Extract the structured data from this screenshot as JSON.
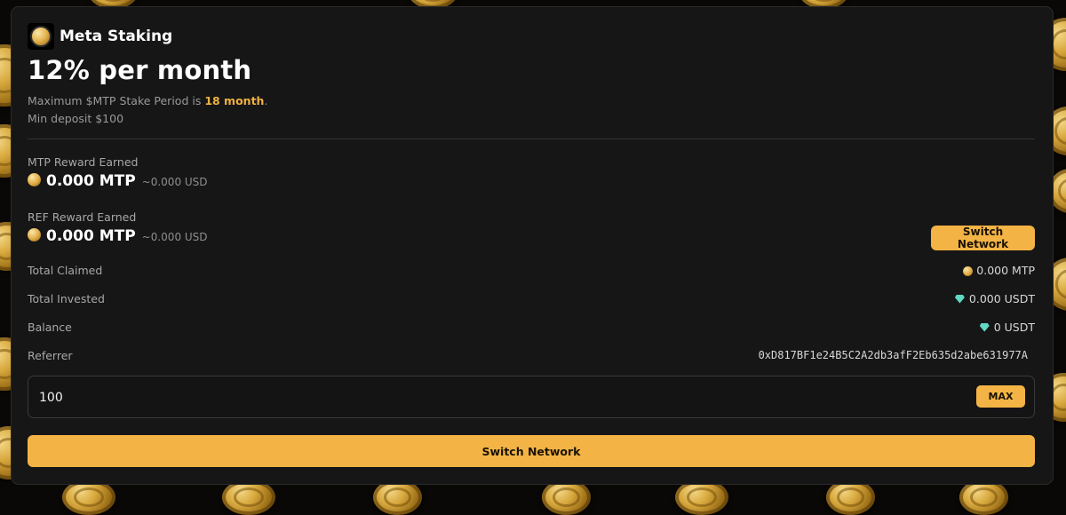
{
  "brand": {
    "name": "Meta Staking"
  },
  "headline": "12% per month",
  "info": {
    "period_prefix": "Maximum $MTP Stake Period is ",
    "period_value": "18 month",
    "period_suffix": ".",
    "min_deposit": "Min deposit $100"
  },
  "mtp_reward": {
    "label": "MTP Reward Earned",
    "amount": "0.000 MTP",
    "usd": "~0.000 USD"
  },
  "ref_reward": {
    "label": "REF Reward Earned",
    "amount": "0.000 MTP",
    "usd": "~0.000 USD"
  },
  "switch_network_small": "Switch Network",
  "stats": {
    "total_claimed": {
      "label": "Total Claimed",
      "value": "0.000 MTP",
      "icon": "mtp-coin-icon"
    },
    "total_invested": {
      "label": "Total Invested",
      "value": "0.000 USDT",
      "icon": "gem-icon"
    },
    "balance": {
      "label": "Balance",
      "value": "0 USDT",
      "icon": "gem-icon"
    },
    "referrer": {
      "label": "Referrer",
      "value": "0xD817BF1e24B5C2A2db3afF2Eb635d2abe631977A"
    }
  },
  "deposit_input": {
    "value": "100",
    "max_label": "MAX"
  },
  "switch_network_big": "Switch Network",
  "colors": {
    "accent": "#f3b445",
    "card": "#161616",
    "highlight_text": "#f0b13f"
  }
}
